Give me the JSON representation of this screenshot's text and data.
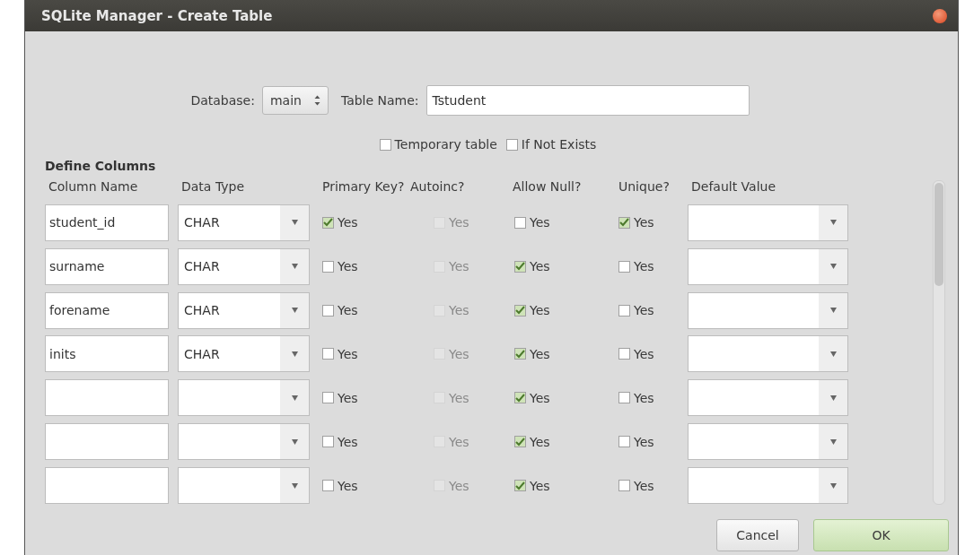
{
  "window": {
    "title": "SQLite Manager - Create Table"
  },
  "database": {
    "label": "Database:",
    "value": "main"
  },
  "table_name": {
    "label": "Table Name:",
    "value": "Tstudent"
  },
  "options": [
    {
      "label": "Temporary table",
      "checked": false
    },
    {
      "label": "If Not Exists",
      "checked": false
    }
  ],
  "section_title": "Define Columns",
  "columns": [
    "Column Name",
    "Data Type",
    "Primary Key?",
    "Autoinc?",
    "Allow Null?",
    "Unique?",
    "Default Value"
  ],
  "rows": [
    {
      "name": "student_id",
      "type": "CHAR",
      "flags": [
        {
          "label": "Yes",
          "checked": true,
          "disabled": false
        },
        {
          "label": "Yes",
          "checked": false,
          "disabled": true
        },
        {
          "label": "Yes",
          "checked": false,
          "disabled": false
        },
        {
          "label": "Yes",
          "checked": true,
          "disabled": false
        }
      ]
    },
    {
      "name": "surname",
      "type": "CHAR",
      "flags": [
        {
          "label": "Yes",
          "checked": false,
          "disabled": false
        },
        {
          "label": "Yes",
          "checked": false,
          "disabled": true
        },
        {
          "label": "Yes",
          "checked": true,
          "disabled": false
        },
        {
          "label": "Yes",
          "checked": false,
          "disabled": false
        }
      ]
    },
    {
      "name": "forename",
      "type": "CHAR",
      "flags": [
        {
          "label": "Yes",
          "checked": false,
          "disabled": false
        },
        {
          "label": "Yes",
          "checked": false,
          "disabled": true
        },
        {
          "label": "Yes",
          "checked": true,
          "disabled": false
        },
        {
          "label": "Yes",
          "checked": false,
          "disabled": false
        }
      ]
    },
    {
      "name": "inits",
      "type": "CHAR",
      "flags": [
        {
          "label": "Yes",
          "checked": false,
          "disabled": false
        },
        {
          "label": "Yes",
          "checked": false,
          "disabled": true
        },
        {
          "label": "Yes",
          "checked": true,
          "disabled": false
        },
        {
          "label": "Yes",
          "checked": false,
          "disabled": false
        }
      ]
    },
    {
      "flags": [
        {
          "label": "Yes",
          "checked": false,
          "disabled": false
        },
        {
          "label": "Yes",
          "checked": false,
          "disabled": true
        },
        {
          "label": "Yes",
          "checked": true,
          "disabled": false
        },
        {
          "label": "Yes",
          "checked": false,
          "disabled": false
        }
      ]
    },
    {
      "flags": [
        {
          "label": "Yes",
          "checked": false,
          "disabled": false
        },
        {
          "label": "Yes",
          "checked": false,
          "disabled": true
        },
        {
          "label": "Yes",
          "checked": true,
          "disabled": false
        },
        {
          "label": "Yes",
          "checked": false,
          "disabled": false
        }
      ]
    },
    {
      "flags": [
        {
          "label": "Yes",
          "checked": false,
          "disabled": false
        },
        {
          "label": "Yes",
          "checked": false,
          "disabled": true
        },
        {
          "label": "Yes",
          "checked": true,
          "disabled": false
        },
        {
          "label": "Yes",
          "checked": false,
          "disabled": false
        }
      ]
    }
  ],
  "buttons": [
    {
      "label": "Cancel",
      "kind": "normal"
    },
    {
      "label": "OK",
      "kind": "default"
    }
  ]
}
